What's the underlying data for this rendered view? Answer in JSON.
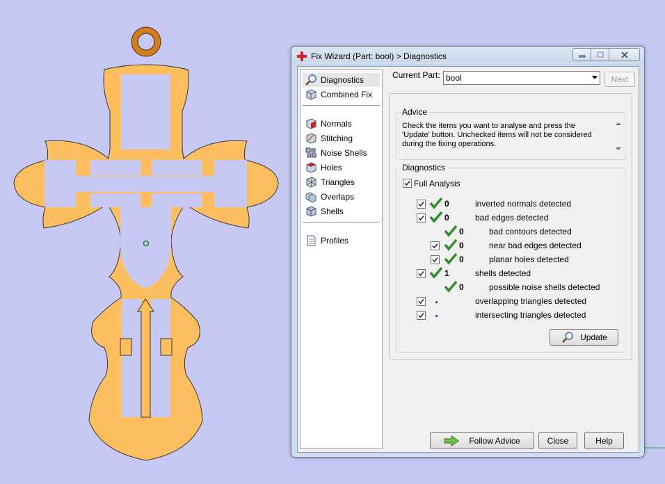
{
  "window": {
    "title": "Fix Wizard (Part: bool) > Diagnostics"
  },
  "nav": {
    "items": [
      {
        "label": "Diagnostics",
        "icon": "magnifier-icon"
      },
      {
        "label": "Combined Fix",
        "icon": "cube-icon"
      },
      {
        "label": "Normals",
        "icon": "normals-icon"
      },
      {
        "label": "Stitching",
        "icon": "stitching-icon"
      },
      {
        "label": "Noise Shells",
        "icon": "noise-shells-icon"
      },
      {
        "label": "Holes",
        "icon": "holes-icon"
      },
      {
        "label": "Triangles",
        "icon": "triangles-icon"
      },
      {
        "label": "Overlaps",
        "icon": "overlaps-icon"
      },
      {
        "label": "Shells",
        "icon": "shells-icon"
      },
      {
        "label": "Profiles",
        "icon": "document-icon"
      }
    ]
  },
  "current_part": {
    "label": "Current Part:",
    "value": "bool"
  },
  "next_label": "Next",
  "advice": {
    "title": "Advice",
    "text": "Check the items you want to analyse and press the 'Update' button. Unchecked items will not be considered during the fixing operations."
  },
  "diagnostics": {
    "title": "Diagnostics",
    "full_analysis": {
      "label": "Full Analysis",
      "checked": true
    },
    "rows": [
      {
        "label": "inverted normals detected",
        "count": "0",
        "checkbox": true,
        "status": "ok"
      },
      {
        "label": "bad edges detected",
        "count": "0",
        "checkbox": true,
        "status": "ok"
      },
      {
        "label": "bad contours detected",
        "count": "0",
        "checkbox": false,
        "status": "ok"
      },
      {
        "label": "near bad edges detected",
        "count": "0",
        "checkbox": true,
        "status": "ok"
      },
      {
        "label": "planar holes detected",
        "count": "0",
        "checkbox": true,
        "status": "ok"
      },
      {
        "label": "shells detected",
        "count": "1",
        "checkbox": true,
        "status": "ok"
      },
      {
        "label": "possible noise shells detected",
        "count": "0",
        "checkbox": false,
        "status": "ok"
      },
      {
        "label": "overlapping triangles detected",
        "count": "",
        "checkbox": true,
        "status": "pending"
      },
      {
        "label": "intersecting triangles detected",
        "count": "",
        "checkbox": true,
        "status": "pending"
      }
    ],
    "update_label": "Update"
  },
  "footer": {
    "follow_advice": "Follow Advice",
    "close": "Close",
    "help": "Help"
  },
  "colors": {
    "background": "#c8c8f4",
    "model_fill": "#fdbe60",
    "check_green": "#2e8b2e"
  }
}
